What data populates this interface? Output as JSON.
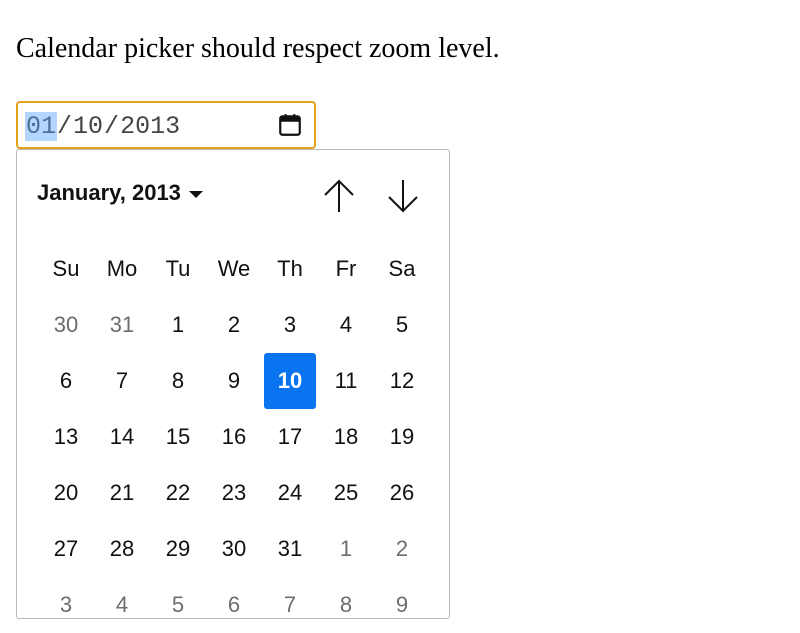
{
  "page": {
    "headline": "Calendar picker should respect zoom level."
  },
  "date_input": {
    "month": "01",
    "day": "10",
    "year": "2013",
    "separator": "/",
    "calendar_icon": "calendar-icon",
    "focus_color": "#e2a21a",
    "selected_segment_color": "#b4d5fe"
  },
  "calendar": {
    "month_label": "January, 2013",
    "nav_up_icon": "arrow-up-icon",
    "nav_down_icon": "arrow-down-icon",
    "weekdays": [
      "Su",
      "Mo",
      "Tu",
      "We",
      "Th",
      "Fr",
      "Sa"
    ],
    "selected_color": "#0a74f0",
    "weeks": [
      [
        {
          "d": "30",
          "other": true
        },
        {
          "d": "31",
          "other": true
        },
        {
          "d": "1"
        },
        {
          "d": "2"
        },
        {
          "d": "3"
        },
        {
          "d": "4"
        },
        {
          "d": "5"
        }
      ],
      [
        {
          "d": "6"
        },
        {
          "d": "7"
        },
        {
          "d": "8"
        },
        {
          "d": "9"
        },
        {
          "d": "10",
          "selected": true
        },
        {
          "d": "11"
        },
        {
          "d": "12"
        }
      ],
      [
        {
          "d": "13"
        },
        {
          "d": "14"
        },
        {
          "d": "15"
        },
        {
          "d": "16"
        },
        {
          "d": "17"
        },
        {
          "d": "18"
        },
        {
          "d": "19"
        }
      ],
      [
        {
          "d": "20"
        },
        {
          "d": "21"
        },
        {
          "d": "22"
        },
        {
          "d": "23"
        },
        {
          "d": "24"
        },
        {
          "d": "25"
        },
        {
          "d": "26"
        }
      ],
      [
        {
          "d": "27"
        },
        {
          "d": "28"
        },
        {
          "d": "29"
        },
        {
          "d": "30"
        },
        {
          "d": "31"
        },
        {
          "d": "1",
          "other": true
        },
        {
          "d": "2",
          "other": true
        }
      ],
      [
        {
          "d": "3",
          "other": true
        },
        {
          "d": "4",
          "other": true
        },
        {
          "d": "5",
          "other": true
        },
        {
          "d": "6",
          "other": true
        },
        {
          "d": "7",
          "other": true
        },
        {
          "d": "8",
          "other": true
        },
        {
          "d": "9",
          "other": true
        }
      ]
    ]
  }
}
